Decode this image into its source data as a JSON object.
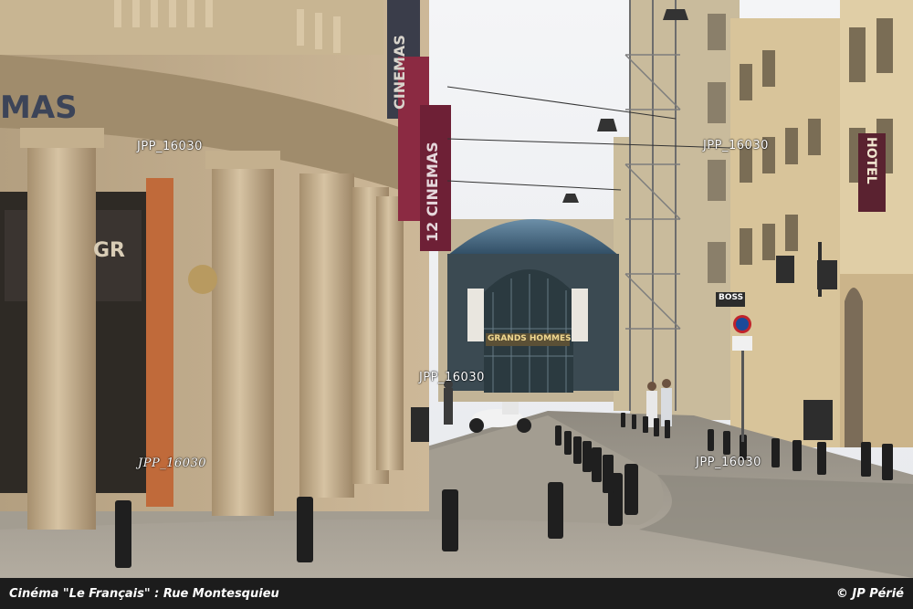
{
  "photo": {
    "caption_left": "Cinéma \"Le Français\" : Rue Montesquieu",
    "caption_right": "© JP Périé",
    "watermarks": [
      "JPP_16030",
      "JPP_16030",
      "JPP_16030",
      "JPP_16030",
      "JPP_16030"
    ],
    "signs": {
      "facade_partial": "MAS",
      "banner_1": "CINEMAS",
      "banner_2": "12 CINEMAS",
      "hotel": "HOTEL",
      "boss": "BOSS",
      "grands_hommes": "GRANDS HOMMES",
      "shop_gr": "GR"
    }
  }
}
